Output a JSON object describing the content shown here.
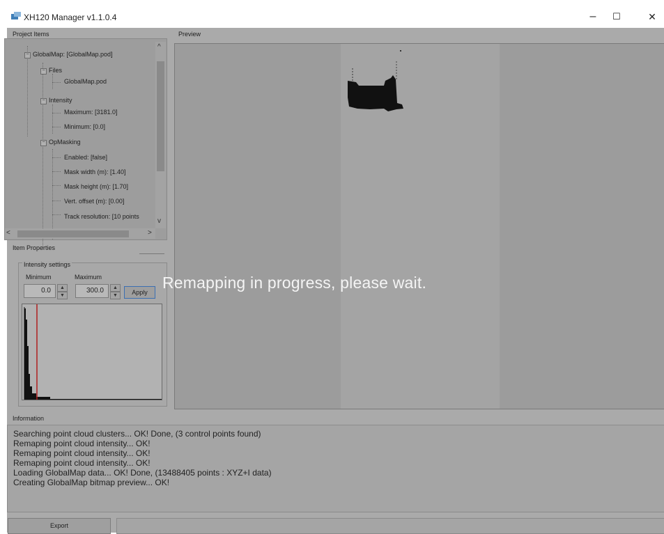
{
  "window": {
    "title": "XH120 Manager v1.1.0.4",
    "minimize_glyph": "–",
    "maximize_glyph": "☐",
    "close_glyph": "✕"
  },
  "project_items": {
    "label": "Project Items",
    "nodes": [
      {
        "text": "GlobalMap: [GlobalMap.pod]",
        "toggle": "−"
      },
      {
        "text": "Files",
        "toggle": "−"
      },
      {
        "text": "GlobalMap.pod"
      },
      {
        "text": "Intensity",
        "toggle": "−"
      },
      {
        "text": "Maximum: [3181.0]"
      },
      {
        "text": "Minimum: [0.0]"
      },
      {
        "text": "OpMasking",
        "toggle": "−"
      },
      {
        "text": "Enabled: [false]"
      },
      {
        "text": "Mask width (m): [1.40]"
      },
      {
        "text": "Mask height (m): [1.70]"
      },
      {
        "text": "Vert. offset (m): [0.00]"
      },
      {
        "text": "Track resolution: [10 points"
      }
    ],
    "scroll_up": "^",
    "scroll_down": "v",
    "scroll_left": "<",
    "scroll_right": ">"
  },
  "item_properties": {
    "label": "Item Properties",
    "intensity_group": "Intensity settings",
    "min_label": "Minimum",
    "max_label": "Maximum",
    "min_value": "0.0",
    "max_value": "300.0",
    "apply_label": "Apply",
    "spin_up": "▲",
    "spin_down": "▼"
  },
  "preview": {
    "label": "Preview",
    "overlay": "Remapping in progress, please wait."
  },
  "information": {
    "label": "Information",
    "lines": [
      "Searching point cloud clusters... OK! Done, (3 control points found)",
      "Remaping point cloud intensity... OK!",
      "Remaping point cloud intensity... OK!",
      "Remaping point cloud intensity... OK!",
      "Loading GlobalMap data... OK! Done, (13488405 points : XYZ+I data)",
      "Creating GlobalMap bitmap preview... OK!"
    ]
  },
  "footer": {
    "export_label": "Export"
  },
  "colors": {
    "histogram_bar": "#111111",
    "histogram_marker": "#b01e1e",
    "accent_button_border": "#3b6fb2"
  }
}
